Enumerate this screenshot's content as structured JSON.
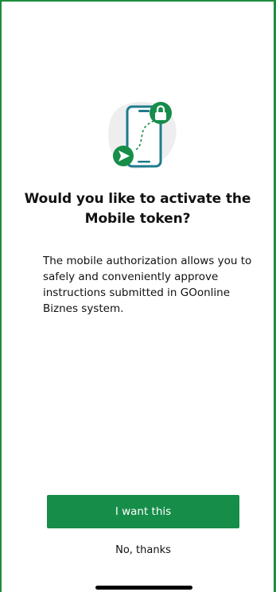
{
  "onboarding": {
    "illustration_icon": "mobile-phone-lock-send-icon",
    "title": "Would you like to activate the Mobile token?",
    "description": "The mobile authorization allows you to safely and conveniently approve instructions submitted in GOonline Biznes system.",
    "primary_button_label": "I want this",
    "secondary_button_label": "No, thanks"
  },
  "colors": {
    "brand_green": "#168d49",
    "frame_green": "#1e8e3e",
    "text": "#111111",
    "background": "#ffffff"
  }
}
